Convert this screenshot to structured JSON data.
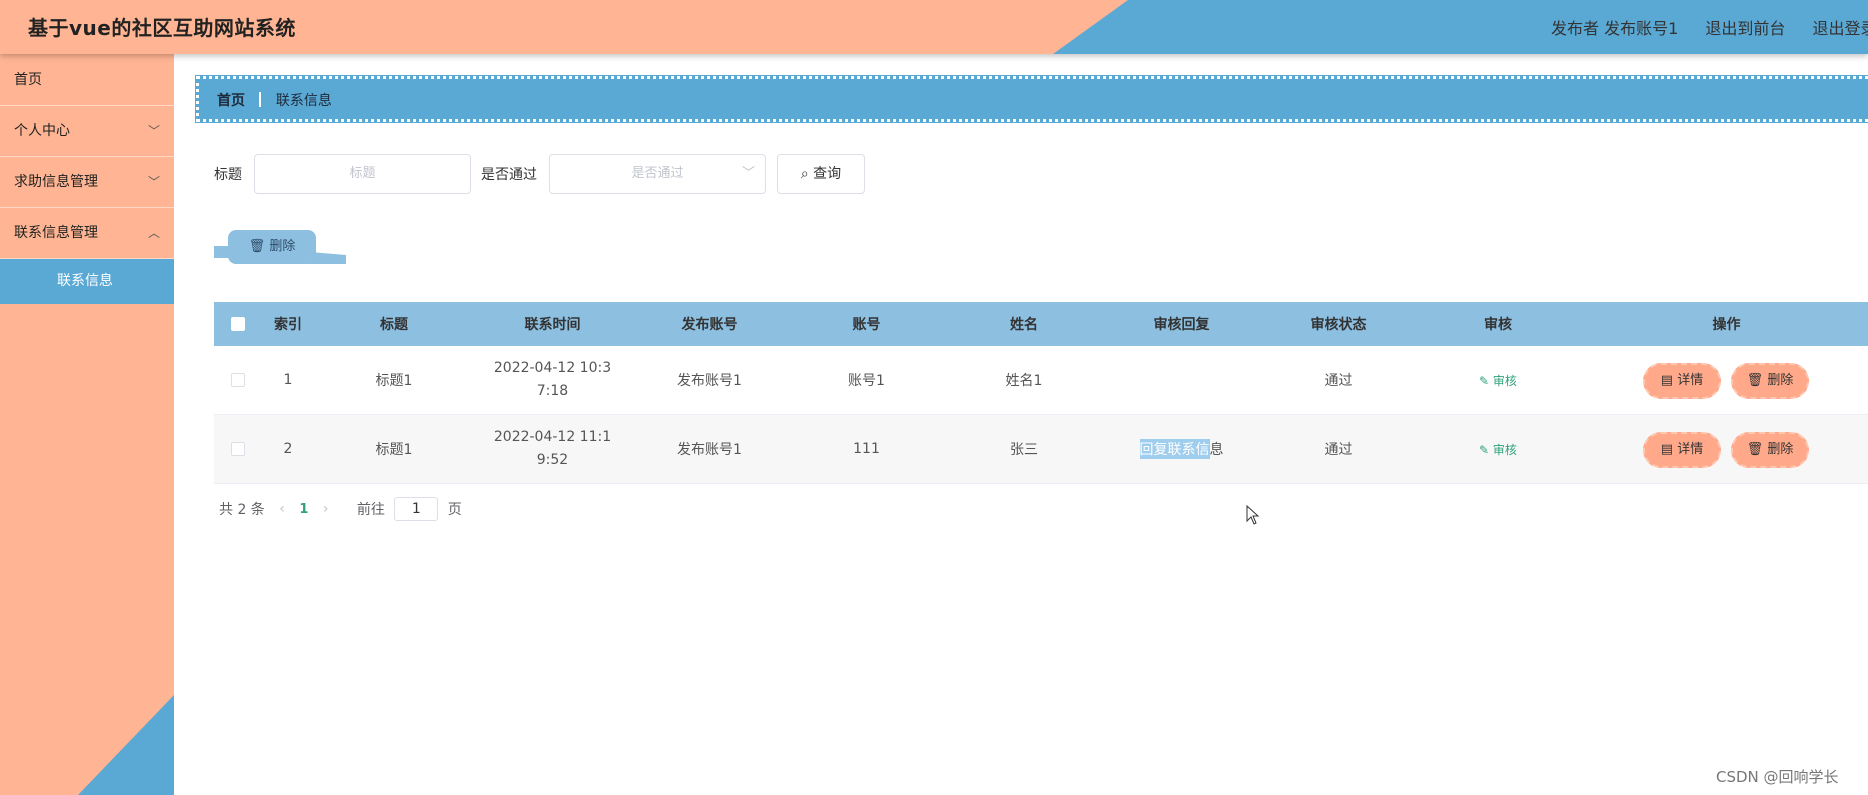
{
  "header": {
    "title": "基于vue的社区互助网站系统",
    "user_label": "发布者 发布账号1",
    "to_front": "退出到前台",
    "logout": "退出登录"
  },
  "sidebar": {
    "items": [
      {
        "label": "首页"
      },
      {
        "label": "个人中心"
      },
      {
        "label": "求助信息管理"
      },
      {
        "label": "联系信息管理"
      }
    ],
    "active_sub": "联系信息"
  },
  "breadcrumb": {
    "home": "首页",
    "current": "联系信息"
  },
  "search": {
    "title_label": "标题",
    "title_placeholder": "标题",
    "pass_label": "是否通过",
    "pass_placeholder": "是否通过",
    "query_label": "查询"
  },
  "toolbar": {
    "delete_label": "删除"
  },
  "table": {
    "headers": [
      "索引",
      "标题",
      "联系时间",
      "发布账号",
      "账号",
      "姓名",
      "审核回复",
      "审核状态",
      "审核",
      "操作"
    ],
    "rows": [
      {
        "index": "1",
        "title": "标题1",
        "time": "2022-04-12 10:37:18",
        "publisher": "发布账号1",
        "account": "账号1",
        "name": "姓名1",
        "reply_hl": "",
        "reply_rest": "",
        "status": "通过",
        "audit": "审核",
        "detail": "详情",
        "delete": "删除"
      },
      {
        "index": "2",
        "title": "标题1",
        "time": "2022-04-12 11:19:52",
        "publisher": "发布账号1",
        "account": "111",
        "name": "张三",
        "reply_hl": "回复联系信",
        "reply_rest": "息",
        "status": "通过",
        "audit": "审核",
        "detail": "详情",
        "delete": "删除"
      }
    ]
  },
  "pagination": {
    "total": "共 2 条",
    "current": "1",
    "goto": "前往",
    "page_input": "1",
    "page_unit": "页"
  },
  "watermark": "CSDN @回响学长",
  "colors": {
    "accent_blue": "#5aa8d4",
    "accent_orange": "#ffb593",
    "link_green": "#30a27a"
  }
}
